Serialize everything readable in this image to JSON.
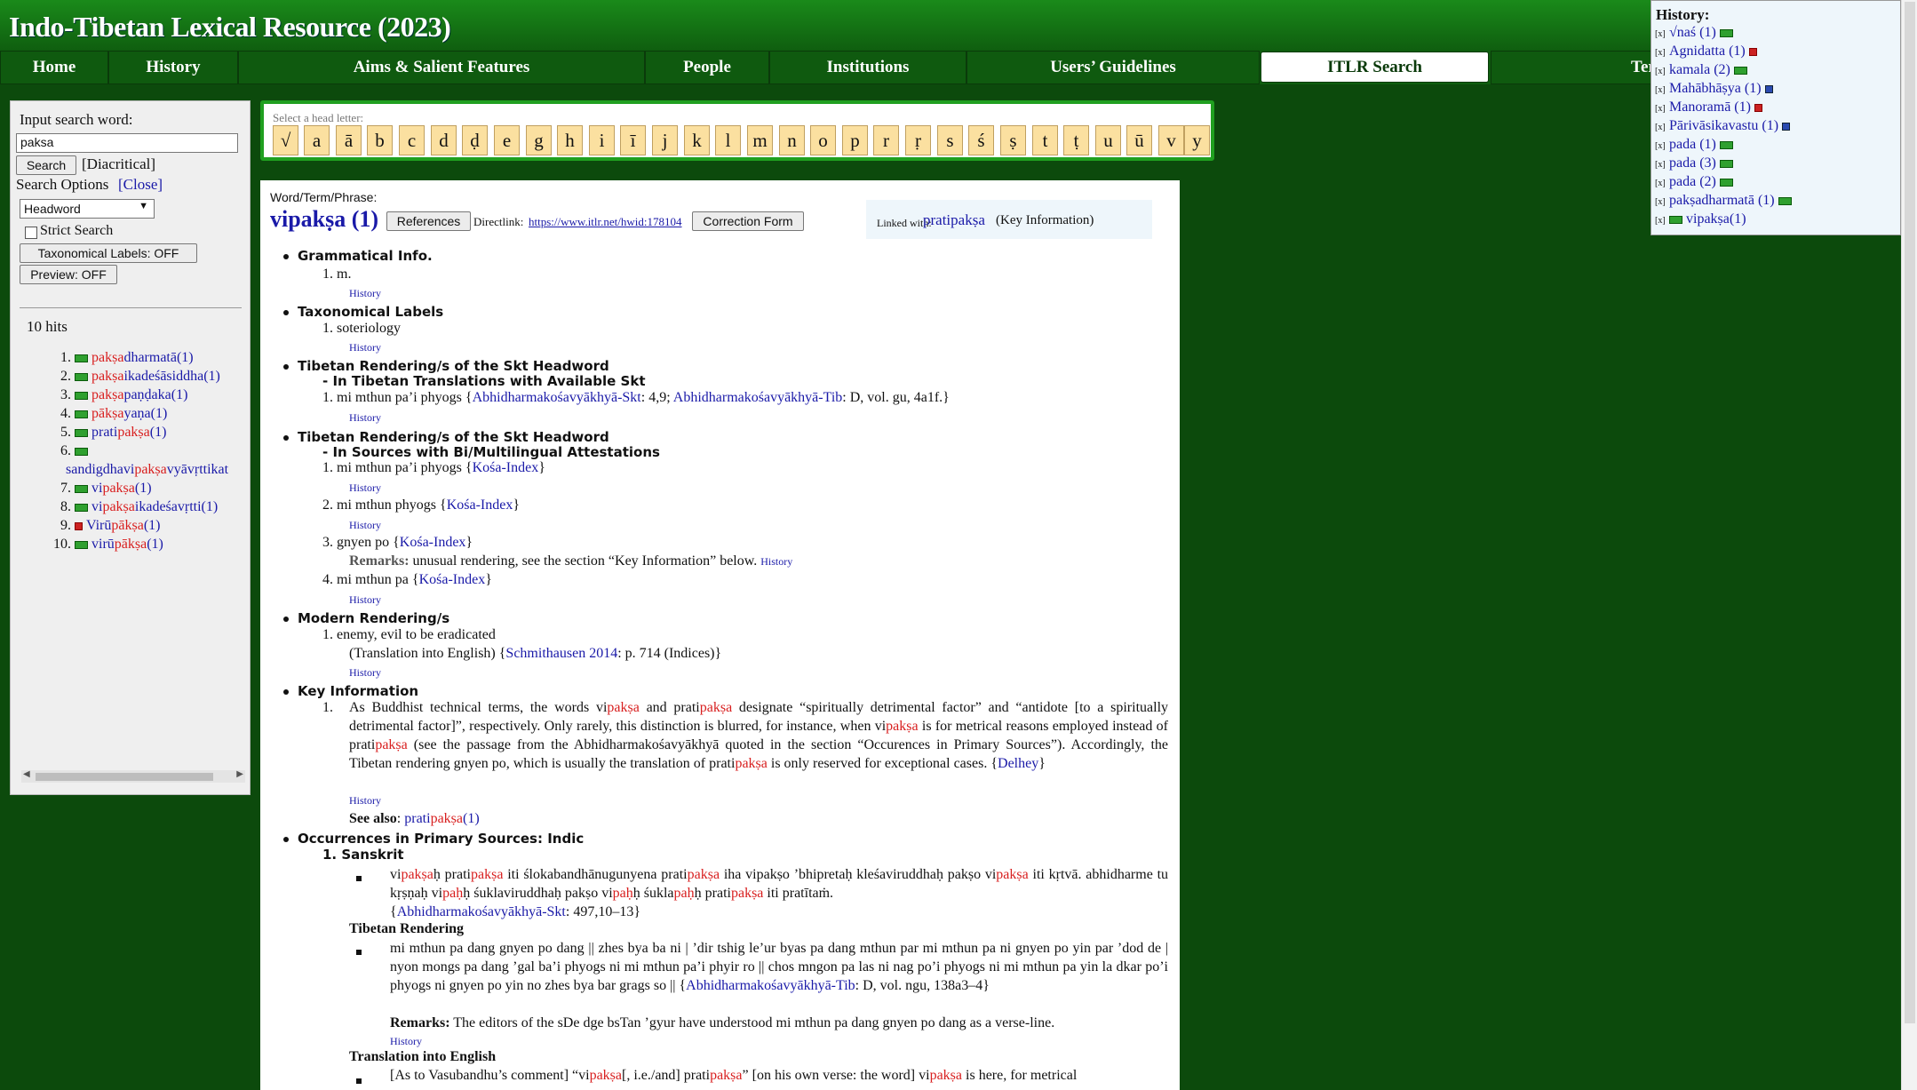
{
  "header": {
    "title": "Indo-Tibetan Lexical Resource (2023)"
  },
  "nav": [
    {
      "label": "Home"
    },
    {
      "label": "History"
    },
    {
      "label": "Aims & Salient Features"
    },
    {
      "label": "People"
    },
    {
      "label": "Institutions"
    },
    {
      "label": "Users’ Guidelines"
    },
    {
      "label": "ITLR Search"
    },
    {
      "label": "Terms of Use"
    }
  ],
  "search": {
    "prompt": "Input search word:",
    "value": "paksa",
    "search_button": "Search",
    "diacritical": "[Diacritical]",
    "options_label": "Search Options",
    "close_link": "[Close]",
    "select_value": "Headword",
    "strict_label": "Strict Search",
    "taxonomical_button": "Taxonomical Labels: OFF",
    "preview_button": "Preview: OFF",
    "hits_count": "10 hits"
  },
  "hits": [
    {
      "num": "1.",
      "pre": "",
      "hl": "pakṣa",
      "post": "dharmatā(1)",
      "tag": "g"
    },
    {
      "num": "2.",
      "pre": "",
      "hl": "pakṣa",
      "post": "ikadeśāsiddha(1)",
      "tag": "g"
    },
    {
      "num": "3.",
      "pre": "",
      "hl": "pakṣa",
      "post": "paṇḍaka(1)",
      "tag": "g"
    },
    {
      "num": "4.",
      "pre": "",
      "hl": "pākṣa",
      "post": "yaṇa(1)",
      "tag": "g"
    },
    {
      "num": "5.",
      "pre": "prati",
      "hl": "pakṣa",
      "post": "(1)",
      "tag": "g"
    },
    {
      "num": "6.",
      "pre": "sandigdhavi",
      "hl": "pakṣa",
      "post": "vyāvṛttikat",
      "tag": "g"
    },
    {
      "num": "7.",
      "pre": "vi",
      "hl": "pakṣa",
      "post": "(1)",
      "tag": "g"
    },
    {
      "num": "8.",
      "pre": "vi",
      "hl": "pakṣa",
      "post": "ikadeśavṛtti(1)",
      "tag": "g"
    },
    {
      "num": "9.",
      "pre": "Virū",
      "hl": "pākṣa",
      "post": "(1)",
      "tag": "r"
    },
    {
      "num": "10.",
      "pre": "virū",
      "hl": "pākṣa",
      "post": "(1)",
      "tag": "g"
    }
  ],
  "letters": {
    "caption": "Select a head letter:",
    "items": [
      "√",
      "a",
      "ā",
      "b",
      "c",
      "d",
      "ḍ",
      "e",
      "g",
      "h",
      "i",
      "ī",
      "j",
      "k",
      "l",
      "m",
      "n",
      "o",
      "p",
      "r",
      "ṛ",
      "s",
      "ś",
      "ṣ",
      "t",
      "ṭ",
      "u",
      "ū",
      "v",
      "y"
    ]
  },
  "entry": {
    "term_label": "Word/Term/Phrase:",
    "headword": "vipakṣa (1)",
    "references_button": "References",
    "directlink_label": "Directlink:",
    "directlink_url": "https://www.itlr.net/hwid:178104",
    "correction_button": "Correction Form",
    "linked_label": "Linked with:",
    "linked_term": "pratipakṣa",
    "linked_suffix": "(Key Information)",
    "history": "History",
    "sec_grammatical": "Grammatical Info.",
    "gram_value": "m.",
    "sec_taxonomical": "Taxonomical Labels",
    "tax_value": "soteriology",
    "sec_tib1": "Tibetan Rendering/s of the Skt Headword",
    "sub_tib1": "In Tibetan Translations with Available Skt",
    "tib1_item": "mi mthun pa’i phyogs {",
    "tib1_src1": "Abhidharmakośavyākhyā-Skt",
    "tib1_mid": ": 4,9; ",
    "tib1_src2": "Abhidharmakośavyākhyā-Tib",
    "tib1_end": ": D, vol. gu, 4a1f.}",
    "sec_tib2": "Tibetan Rendering/s of the Skt Headword",
    "sub_tib2": "In Sources with Bi/Multilingual Attestations",
    "tib2_items": [
      "mi mthun pa’i phyogs {",
      "mi mthun phyogs {",
      "gnyen po {",
      "mi mthun pa {"
    ],
    "kosa": "Kośa-Index",
    "close_brace": "}",
    "remarks_label": "Remarks:",
    "remarks_text": "unusual rendering, see the section “Key Information” below.",
    "sec_modern": "Modern Rendering/s",
    "modern_value": "enemy, evil to be eradicated",
    "modern_trans": "(Translation into English) {",
    "modern_src": "Schmithausen 2014",
    "modern_end": ": p. 714 (Indices)}",
    "sec_key": "Key Information",
    "key_para_1a": "As Buddhist technical terms, the words vi",
    "key_para_1b": " and prati",
    "key_para_1c": " designate “spiritually detrimental factor” and “antidote [to a spiritually detrimental factor]”, respectively. Only rarely, this distinction is blurred, for instance, when vi",
    "key_para_1d": " is for metrical reasons employed instead of prati",
    "key_para_1e": " (see the passage from the Abhidharmakośavyākhyā quoted in the section “Occurences in Primary Sources”). Accordingly, the Tibetan rendering gnyen po, which is usually the translation of prati",
    "key_para_1f": " is only reserved for exceptional cases. {",
    "key_src": "Delhey",
    "hl_paksa": "pakṣa",
    "see_also_label": "See also",
    "see_also_pre": "prati",
    "see_also_post": "(1)",
    "sec_occ": "Occurrences in Primary Sources: Indic",
    "occ_sanskrit": "Sanskrit",
    "skt_a": "vi",
    "skt_b": "paḥ",
    "skt_c": "ḥ prati",
    "skt_d": " iti ślokabandhānugunyena prati",
    "skt_e": " iha vipakṣo ’bhipretaḥ kleśaviruddhaḥ pakṣo vi",
    "skt_f": " iti kṛtvā.",
    "skt_line2_a": "abhidharme tu kṛṣṇaḥ vi",
    "skt_line2_b": "ḥ śuklaviruddhaḥ pakṣo vi",
    "skt_line2_c": "ḥ śukla",
    "skt_line2_d": "ḥ prati",
    "skt_line2_e": " iti pratītaṁ.",
    "skt_src": "Abhidharmakośavyākhyā-Skt",
    "skt_src_end": ": 497,10–13}",
    "tib_rendering": "Tibetan Rendering",
    "tib_text": "mi mthun pa dang gnyen po dang || zhes bya ba ni | ’dir tshig le’ur byas pa dang mthun par mi mthun pa ni gnyen po yin par ’dod de | nyon mongs pa dang ’gal ba’i phyogs ni mi mthun pa’i phyir ro || chos mngon pa las ni nag po’i phyogs ni mi mthun pa yin la dkar po’i phyogs ni gnyen po yin no zhes bya bar grags so || {",
    "tib_src": "Abhidharmakośavyākhyā-Tib",
    "tib_src_end": ": D, vol. ngu, 138a3–4}",
    "tib_remarks": "The editors of the sDe dge bsTan ’gyur have understood mi mthun pa dang gnyen po dang as a verse-line.",
    "trans_english": "Translation into English",
    "trans_a": "[As to Vasubandhu’s comment] “vi",
    "trans_b": "[, i.e./and] prati",
    "trans_c": "” [on his own verse: the word] vi",
    "trans_d": " is here, for metrical"
  },
  "history_panel": {
    "title": "History:",
    "items": [
      {
        "text": "√naś (1)",
        "tag": "g"
      },
      {
        "text": "Agnidatta (1)",
        "tag": "r"
      },
      {
        "text": "kamala (2)",
        "tag": "g"
      },
      {
        "text": "Mahābhāṣya (1)",
        "tag": "b"
      },
      {
        "text": "Manoramā (1)",
        "tag": "r"
      },
      {
        "text": "Pārivāsikavastu (1)",
        "tag": "b"
      },
      {
        "text": "pada (1)",
        "tag": "g"
      },
      {
        "text": "pada (3)",
        "tag": "g"
      },
      {
        "text": "pada (2)",
        "tag": "g"
      },
      {
        "text": "pakṣadharmatā (1)",
        "tag": "g"
      },
      {
        "text": "vipakṣa(1)",
        "tag": "g"
      }
    ]
  }
}
